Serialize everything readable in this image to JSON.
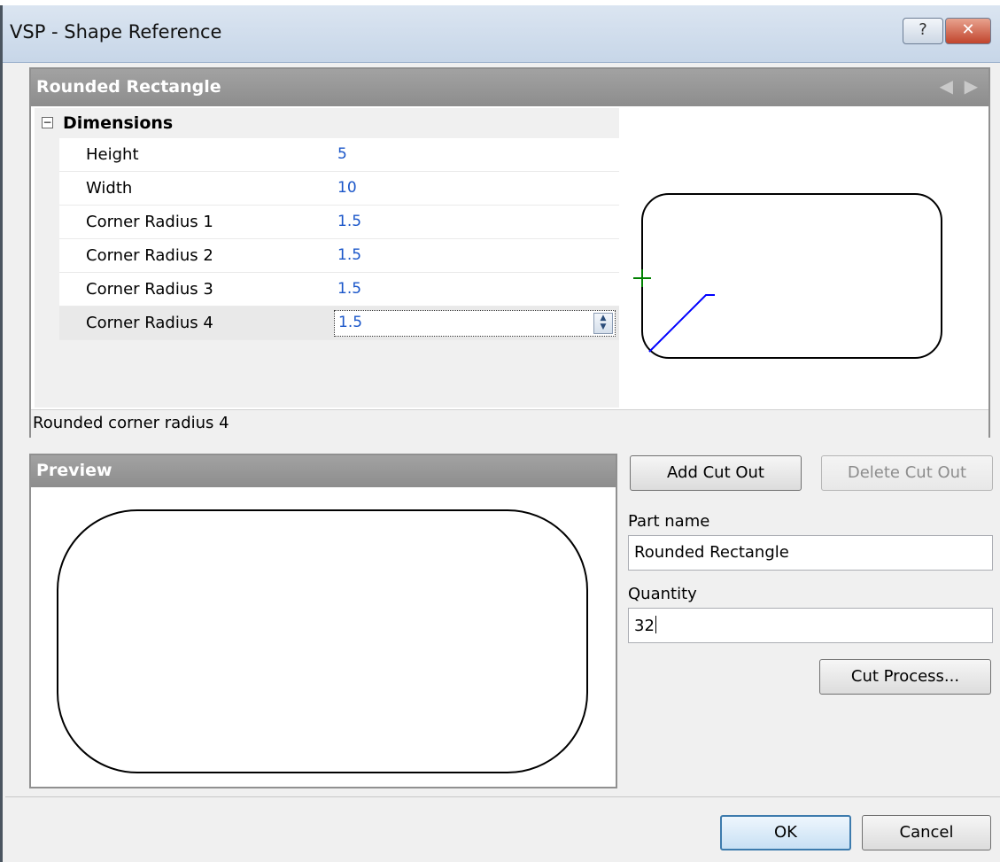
{
  "window": {
    "title": "VSP - Shape Reference",
    "help_glyph": "?",
    "close_glyph": "✕"
  },
  "shape_panel": {
    "title": "Rounded Rectangle",
    "nav_prev_glyph": "◀",
    "nav_next_glyph": "▶",
    "category": "Dimensions",
    "expander_glyph": "−",
    "properties": [
      {
        "name": "Height",
        "value": "5"
      },
      {
        "name": "Width",
        "value": "10"
      },
      {
        "name": "Corner Radius 1",
        "value": "1.5"
      },
      {
        "name": "Corner Radius 2",
        "value": "1.5"
      },
      {
        "name": "Corner Radius 3",
        "value": "1.5"
      },
      {
        "name": "Corner Radius 4",
        "value": "1.5"
      }
    ],
    "description": "Rounded corner radius 4"
  },
  "preview": {
    "title": "Preview"
  },
  "actions": {
    "add_cut_out": "Add Cut Out",
    "delete_cut_out": "Delete Cut Out",
    "cut_process": "Cut Process...",
    "ok": "OK",
    "cancel": "Cancel"
  },
  "form": {
    "part_name_label": "Part name",
    "part_name_value": "Rounded Rectangle",
    "quantity_label": "Quantity",
    "quantity_value": "32"
  },
  "colors": {
    "header_bar": "#999999",
    "value_text": "#1a56c9",
    "highlight_line": "#0000ff",
    "origin_marker": "#008000"
  }
}
